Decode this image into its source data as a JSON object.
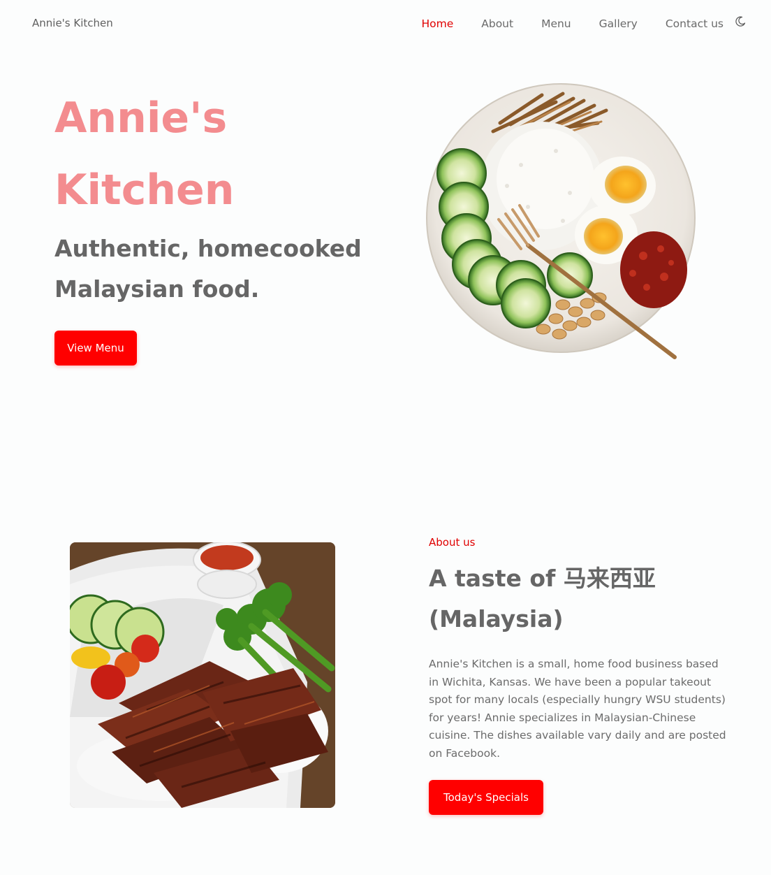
{
  "header": {
    "brand": "Annie's Kitchen",
    "nav": [
      {
        "label": "Home",
        "active": true
      },
      {
        "label": "About",
        "active": false
      },
      {
        "label": "Menu",
        "active": false
      },
      {
        "label": "Gallery",
        "active": false
      },
      {
        "label": "Contact us",
        "active": false
      }
    ],
    "theme_toggle_icon": "moon-icon"
  },
  "hero": {
    "title_line1": "Annie's",
    "title_line2": "Kitchen",
    "subtitle_line1": "Authentic, homecooked",
    "subtitle_line2": "Malaysian food.",
    "button_label": "View Menu",
    "image": "nasi-lemak-plate"
  },
  "about": {
    "eyebrow": "About us",
    "title_line1": "A taste of 马来西亚",
    "title_line2": "(Malaysia)",
    "body": "Annie's Kitchen is a small, home food business based in Wichita, Kansas. We have been a popular takeout spot for many locals (especially hungry WSU students) for years! Annie specializes in Malaysian-Chinese cuisine. The dishes available vary daily and are posted on Facebook.",
    "button_label": "Today's Specials",
    "image": "char-siu-takeout-box"
  },
  "colors": {
    "accent": "#ff0000",
    "nav_active": "#e00000",
    "hero_title": "#f38c8f",
    "text": "#666666",
    "background": "#fcfdfd"
  }
}
